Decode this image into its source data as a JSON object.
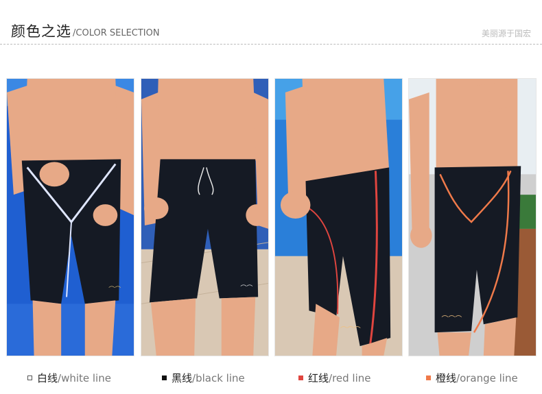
{
  "header": {
    "title_cn": "颜色之选",
    "title_en": "/COLOR SELECTION",
    "brand": "美丽源于国宏"
  },
  "variants": [
    {
      "name_cn": "白线",
      "name_en": "/white line",
      "swatch_color": "#ffffff",
      "stripe_color": "#dfe6ff"
    },
    {
      "name_cn": "黑线",
      "name_en": "/black line",
      "swatch_color": "#111111",
      "stripe_color": "#1a1a1a"
    },
    {
      "name_cn": "红线",
      "name_en": "/red line",
      "swatch_color": "#e0453f",
      "stripe_color": "#e0453f"
    },
    {
      "name_cn": "橙线",
      "name_en": "/orange line",
      "swatch_color": "#f07a4a",
      "stripe_color": "#f07a4a"
    }
  ],
  "colors": {
    "skin": "#e7a987",
    "skin_shadow": "#c98566",
    "pool_blue": "#1f5fd1",
    "pool_light": "#4ea3f0",
    "deck": "#d9c8b4",
    "shorts": "#151a24"
  }
}
